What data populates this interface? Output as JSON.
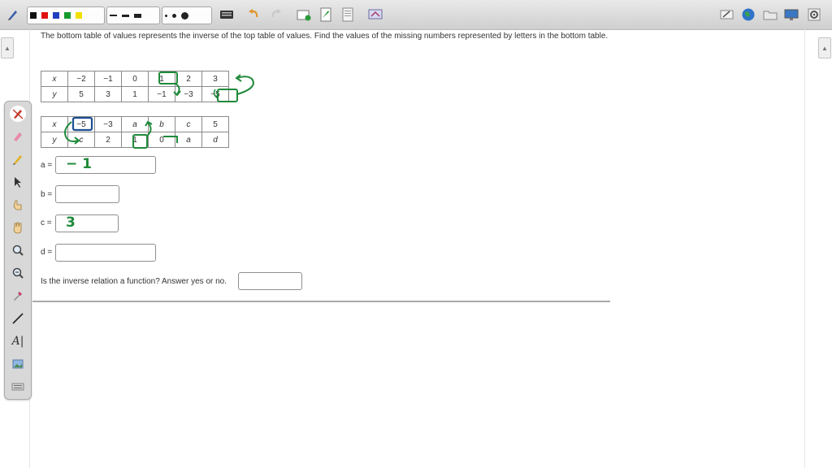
{
  "question": {
    "prompt": "The bottom table of values represents the inverse of the top table of values. Find the values of the missing numbers represented by letters in the bottom table.",
    "final_question": "Is the inverse relation a function? Answer yes or no."
  },
  "top_table": {
    "row1": [
      "x",
      "−2",
      "−1",
      "0",
      "1",
      "2",
      "3"
    ],
    "row2": [
      "y",
      "5",
      "3",
      "1",
      "−1",
      "−3",
      "−5"
    ]
  },
  "bottom_table": {
    "row1": [
      "x",
      "−5",
      "−3",
      "a",
      "b",
      "c",
      "5"
    ],
    "row2": [
      "y",
      "c",
      "2",
      "1",
      "0",
      "a",
      "d"
    ]
  },
  "answers": {
    "a_label": "a =",
    "a_value": "− 1",
    "b_label": "b =",
    "b_value": "",
    "c_label": "c =",
    "c_value": "3",
    "d_label": "d =",
    "d_value": "",
    "function_value": ""
  },
  "colors": {
    "annotation_green": "#1f8a3a",
    "annotation_blue": "#1d4f91",
    "toolbar_bg": "#dcdcdc"
  },
  "toolbar_icons": [
    "pen-icon",
    "color-swatches",
    "line-width-swatches",
    "dot-size-swatches",
    "keyboard-icon",
    "undo-icon",
    "redo-icon",
    "add-page-icon",
    "insert-icon",
    "document-icon",
    "screen-capture-icon",
    "eraser-icon",
    "globe-icon",
    "folder-icon",
    "display-icon",
    "settings-icon"
  ],
  "palette_tools": [
    "pen-tool-icon",
    "highlighter-icon",
    "pencil-icon",
    "pointer-icon",
    "hand-pointer-icon",
    "hand-icon",
    "zoom-in-icon",
    "zoom-out-icon",
    "eyedropper-icon",
    "line-icon",
    "text-tool-icon",
    "image-icon",
    "keyboard-small-icon"
  ],
  "text_tool_glyph": "A|"
}
